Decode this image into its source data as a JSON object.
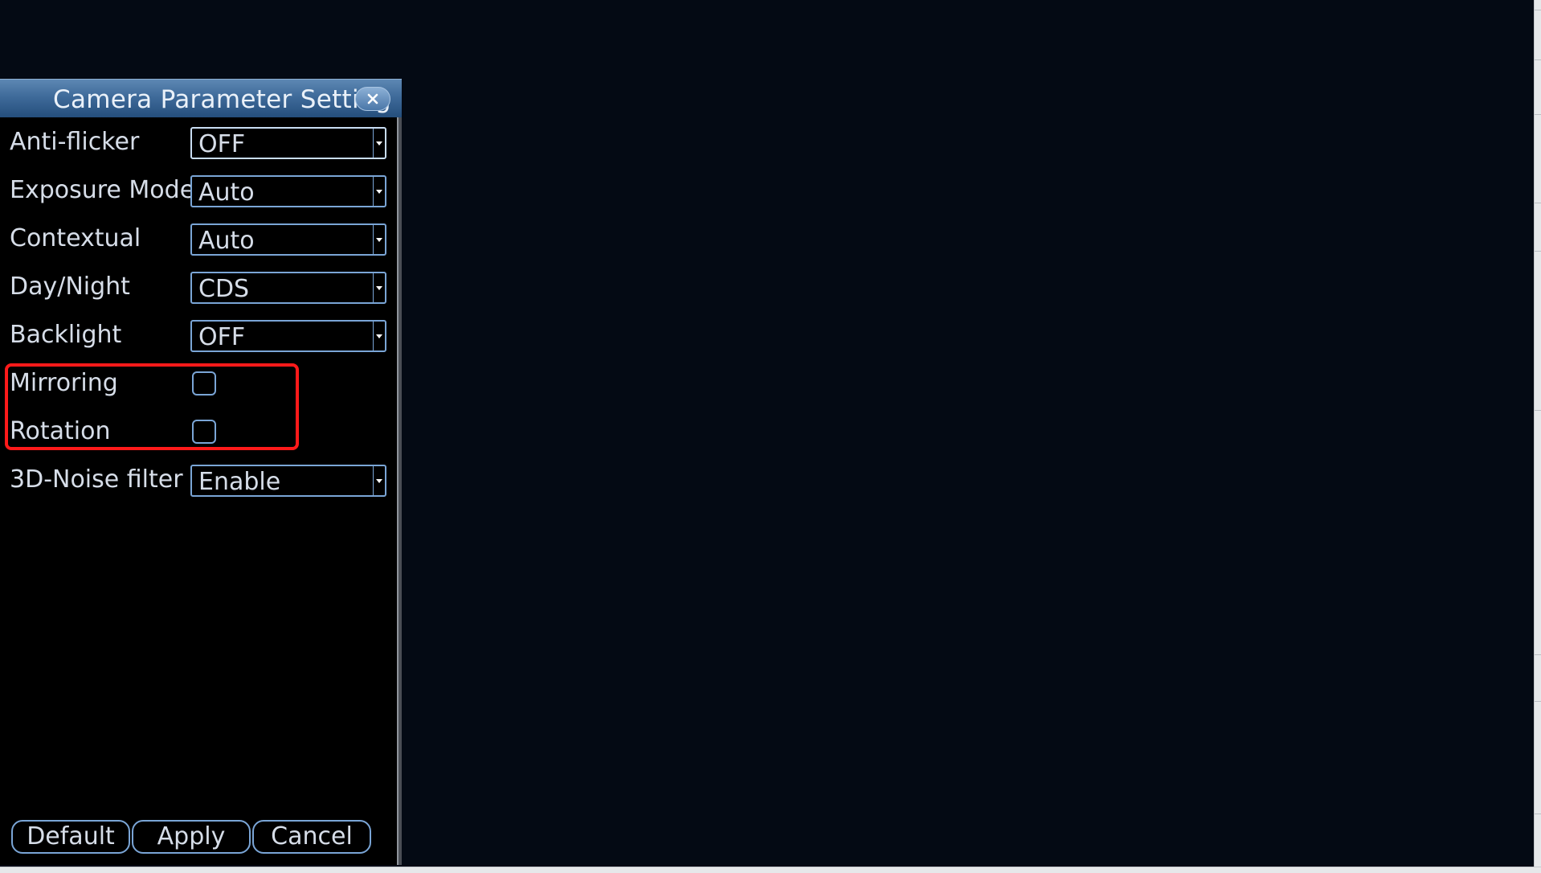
{
  "dialog": {
    "title": "Camera Parameter Setting",
    "close_icon": "close-icon"
  },
  "settings": [
    {
      "label": "Anti-flicker",
      "type": "select",
      "value": "OFF",
      "focused": true
    },
    {
      "label": "Exposure Mode",
      "type": "select",
      "value": "Auto"
    },
    {
      "label": "Contextual",
      "type": "select",
      "value": "Auto"
    },
    {
      "label": "Day/Night",
      "type": "select",
      "value": "CDS"
    },
    {
      "label": "Backlight",
      "type": "select",
      "value": "OFF"
    },
    {
      "label": "Mirroring",
      "type": "checkbox",
      "checked": false
    },
    {
      "label": "Rotation",
      "type": "checkbox",
      "checked": false
    },
    {
      "label": "3D-Noise filter",
      "type": "select",
      "value": "Enable"
    }
  ],
  "buttons": {
    "default_label": "Default",
    "apply_label": "Apply",
    "cancel_label": "Cancel"
  },
  "colors": {
    "accent": "#7aa5d6",
    "highlight": "#ff1a1a",
    "titlebar": "#3f6b9a"
  }
}
